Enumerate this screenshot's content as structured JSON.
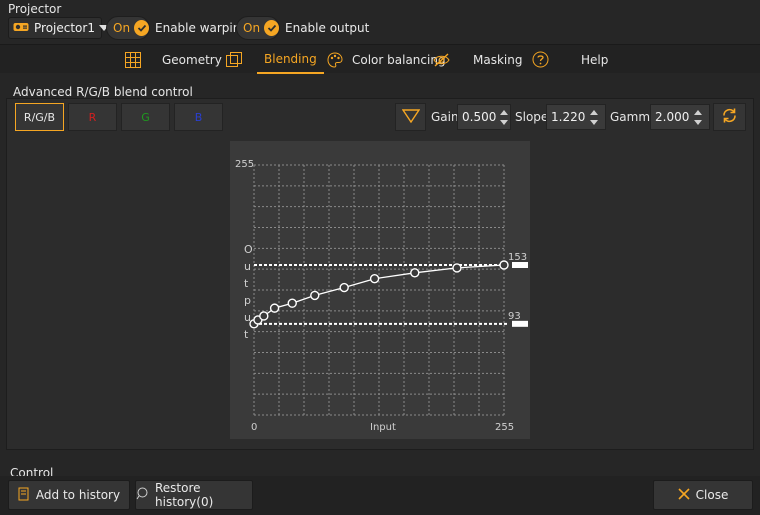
{
  "projector": {
    "section_label": "Projector",
    "selected": "Projector1",
    "warping": {
      "state": "On",
      "label": "Enable warping"
    },
    "output": {
      "state": "On",
      "label": "Enable output"
    }
  },
  "tabs": [
    {
      "label": "Geometry"
    },
    {
      "label": "Blending",
      "active": true
    },
    {
      "label": "Color balancing"
    },
    {
      "label": "Masking"
    },
    {
      "label": "Help"
    }
  ],
  "blend": {
    "title": "Advanced R/G/B blend control",
    "channels": [
      {
        "label": "R/G/B",
        "color": "#e8e8e8",
        "selected": true
      },
      {
        "label": "R",
        "color": "#d22020"
      },
      {
        "label": "G",
        "color": "#1f9a1f"
      },
      {
        "label": "B",
        "color": "#2a3fd0"
      }
    ],
    "gain": {
      "label": "Gain",
      "value": "0.500"
    },
    "slope": {
      "label": "Slope",
      "value": "1.220"
    },
    "gamma": {
      "label": "Gamma",
      "value": "2.000"
    }
  },
  "chart_data": {
    "type": "line",
    "xlabel": "Input",
    "ylabel": "Output",
    "x_ticks": [
      "0",
      "255"
    ],
    "y_ticks": [
      "255"
    ],
    "xlim": [
      0,
      255
    ],
    "ylim": [
      0,
      255
    ],
    "upper_line": {
      "value": 153,
      "label": "153"
    },
    "lower_line": {
      "value": 93,
      "label": "93"
    },
    "points": [
      {
        "x": 0,
        "y": 93
      },
      {
        "x": 4,
        "y": 97
      },
      {
        "x": 10,
        "y": 101
      },
      {
        "x": 21,
        "y": 109
      },
      {
        "x": 39,
        "y": 114
      },
      {
        "x": 62,
        "y": 122
      },
      {
        "x": 92,
        "y": 130
      },
      {
        "x": 123,
        "y": 139
      },
      {
        "x": 164,
        "y": 145
      },
      {
        "x": 207,
        "y": 150
      },
      {
        "x": 255,
        "y": 153
      }
    ],
    "grid": true
  },
  "control": {
    "section_label": "Control",
    "add_history": "Add to history",
    "restore_history": "Restore history(0)",
    "close": "Close"
  },
  "colors": {
    "accent": "#f5a623",
    "background": "#262626"
  }
}
